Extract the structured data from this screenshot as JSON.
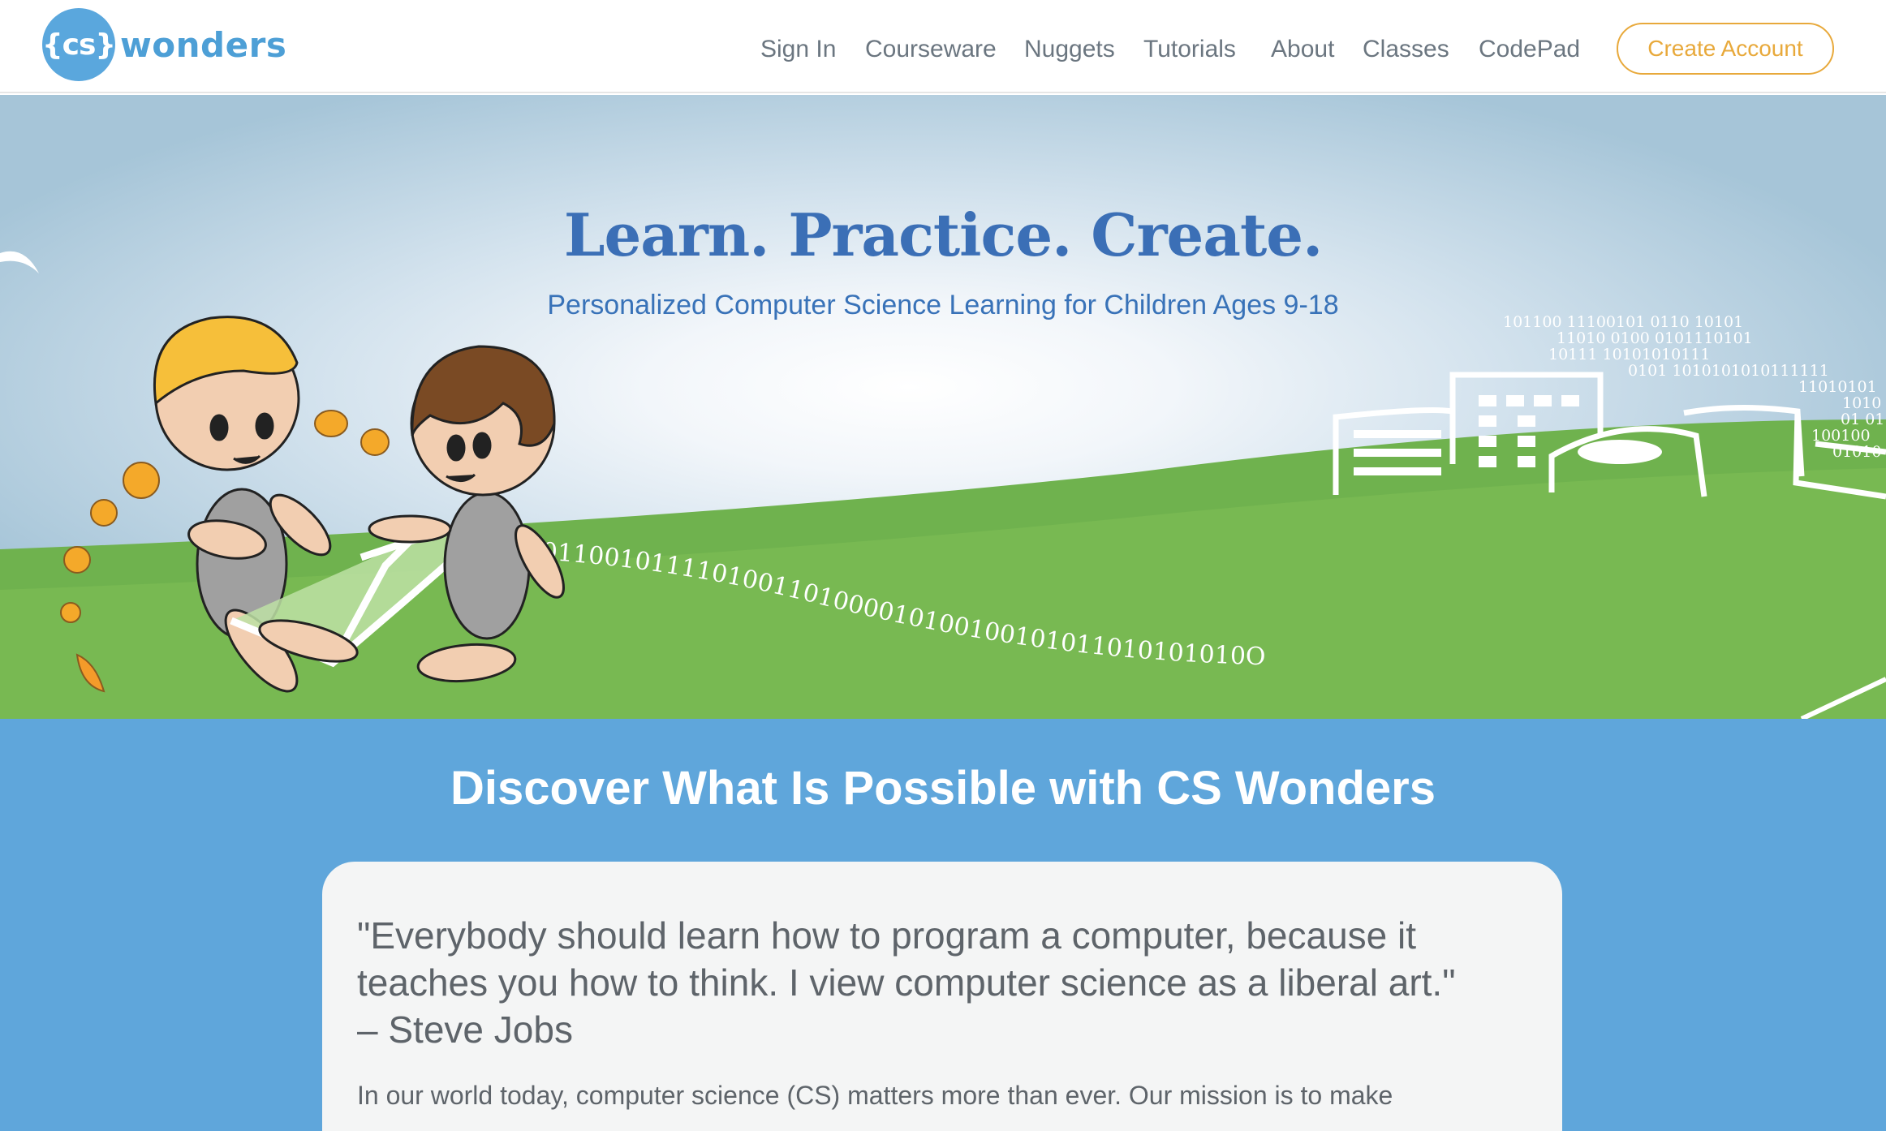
{
  "brand": {
    "logo_mark": "{cs}",
    "logo_word": "wonders",
    "accent_color": "#5aa7dd",
    "button_color": "#e8a93b"
  },
  "nav": {
    "links": [
      {
        "label": "Sign In"
      },
      {
        "label": "Courseware"
      },
      {
        "label": "Nuggets"
      },
      {
        "label": "Tutorials"
      },
      {
        "label": "About"
      },
      {
        "label": "Classes"
      },
      {
        "label": "CodePad"
      }
    ],
    "create_account": "Create Account"
  },
  "hero": {
    "title": "Learn. Practice. Create.",
    "subtitle": "Personalized Computer Science Learning for Children Ages 9-18",
    "binary_trail": "0110110010111101001101000010100100101011010101010O",
    "binary_block": [
      "101100    11100101 0110 10101",
      "11010 0100 0101110101",
      "10111  10101010111",
      "0101  1010101010111111",
      "11010101",
      "1010",
      "01 01",
      "100100",
      "01010"
    ]
  },
  "discover": {
    "title": "Discover What Is Possible with CS Wonders",
    "quote": "\"Everybody should learn how to program a computer, because it teaches you how to think. I view computer science as a liberal art.\"",
    "quote_author": "– Steve Jobs",
    "mission": "In our world today, computer science (CS) matters more than ever. Our mission is to make"
  }
}
